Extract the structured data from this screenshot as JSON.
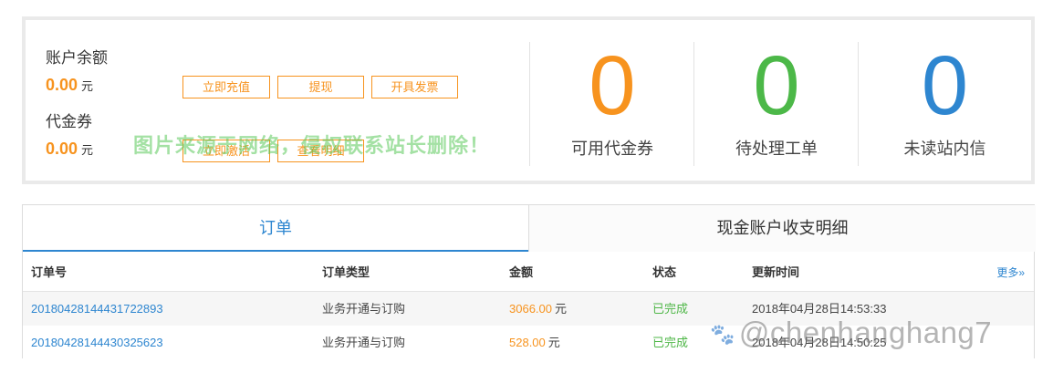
{
  "account": {
    "balance_label": "账户余额",
    "balance_value": "0.00",
    "balance_unit": "元",
    "voucher_label": "代金券",
    "voucher_value": "0.00",
    "voucher_unit": "元",
    "buttons": {
      "recharge": "立即充值",
      "withdraw": "提现",
      "invoice": "开具发票",
      "activate": "立即激活",
      "details": "查看明细"
    }
  },
  "stats": [
    {
      "value": "0",
      "label": "可用代金券",
      "color": "#f7931e"
    },
    {
      "value": "0",
      "label": "待处理工单",
      "color": "#4cb848"
    },
    {
      "value": "0",
      "label": "未读站内信",
      "color": "#2e86d0"
    }
  ],
  "watermark_text": "图片来源于网络，侵权联系站长删除！",
  "watermark2_text": "@chenhanghang7",
  "tabs": {
    "orders": "订单",
    "cash_flow": "现金账户收支明细"
  },
  "table": {
    "headers": {
      "order_no": "订单号",
      "order_type": "订单类型",
      "amount": "金额",
      "status": "状态",
      "updated": "更新时间",
      "more": "更多»"
    },
    "rows": [
      {
        "order_no": "20180428144431722893",
        "order_type": "业务开通与订购",
        "amount": "3066.00",
        "unit": "元",
        "status": "已完成",
        "updated": "2018年04月28日14:53:33"
      },
      {
        "order_no": "20180428144430325623",
        "order_type": "业务开通与订购",
        "amount": "528.00",
        "unit": "元",
        "status": "已完成",
        "updated": "2018年04月28日14:50:25"
      }
    ]
  },
  "colors": {
    "accent_orange": "#f7931e",
    "accent_green": "#4cb848",
    "accent_blue": "#2e86d0"
  }
}
